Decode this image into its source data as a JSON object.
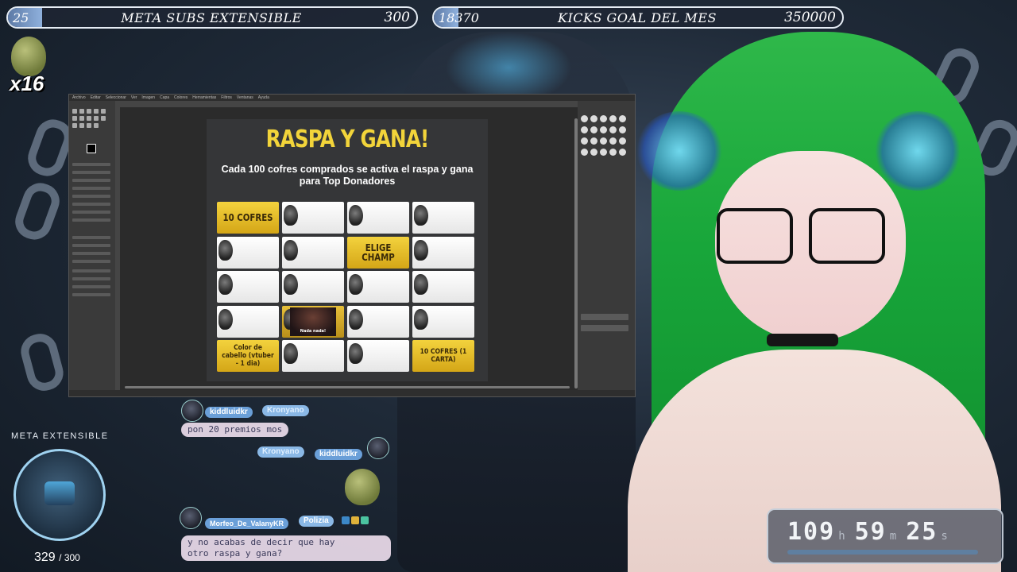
{
  "goals": [
    {
      "current": "25",
      "title": "META SUBS EXTENSIBLE",
      "target": "300",
      "progress": 0.083
    },
    {
      "current": "18370",
      "title": "KICKS GOAL DEL MES",
      "target": "350000",
      "progress": 0.052
    }
  ],
  "combo": {
    "count_text": "x16"
  },
  "editor": {
    "menu": [
      "Archivo",
      "Editar",
      "Seleccionar",
      "Ver",
      "Imagen",
      "Capa",
      "Colores",
      "Herramientas",
      "Filtros",
      "Ventanas",
      "Ayuda"
    ]
  },
  "document": {
    "title": "RASPA Y GANA!",
    "subtitle": "Cada 100 cofres comprados se activa el raspa y gana para Top Donadores",
    "cards": [
      {
        "type": "prize",
        "label": "10 COFRES"
      },
      {
        "type": "blank",
        "label": ""
      },
      {
        "type": "blank",
        "label": ""
      },
      {
        "type": "blank",
        "label": ""
      },
      {
        "type": "blank",
        "label": ""
      },
      {
        "type": "blank",
        "label": ""
      },
      {
        "type": "prize",
        "label": "ELIGE CHAMP"
      },
      {
        "type": "blank",
        "label": ""
      },
      {
        "type": "blank",
        "label": ""
      },
      {
        "type": "blank",
        "label": ""
      },
      {
        "type": "blank",
        "label": ""
      },
      {
        "type": "blank",
        "label": ""
      },
      {
        "type": "blank",
        "label": ""
      },
      {
        "type": "photo",
        "label": "Nada nada!"
      },
      {
        "type": "blank",
        "label": ""
      },
      {
        "type": "blank",
        "label": ""
      },
      {
        "type": "prize-small",
        "label": "Color de cabello (vtuber - 1 dia)"
      },
      {
        "type": "blank",
        "label": ""
      },
      {
        "type": "blank",
        "label": ""
      },
      {
        "type": "prize-small",
        "label": "10 COFRES (1 CARTA)"
      }
    ]
  },
  "chat": {
    "msg1": {
      "user": "kiddluidkr",
      "tag": "Kronyano",
      "text": "pon 20 premios mos"
    },
    "msg2": {
      "user": "kiddluidkr",
      "tag": "Kronyano"
    },
    "msg3": {
      "user": "Morfeo_De_ValanyKR",
      "tag": "Polizia",
      "text_line1": "y no acabas de decir que hay",
      "text_line2": "otro raspa y gana?"
    }
  },
  "meta": {
    "label": "META EXTENSIBLE",
    "current": "329",
    "target": "/ 300"
  },
  "timer": {
    "hours": "109",
    "h_unit": "h",
    "minutes": "59",
    "m_unit": "m",
    "seconds": "25",
    "s_unit": "s"
  },
  "colors": {
    "accent_yellow": "#f2d43a",
    "hair_green": "#18a63a",
    "goal_fill": "#8fb1dd"
  }
}
